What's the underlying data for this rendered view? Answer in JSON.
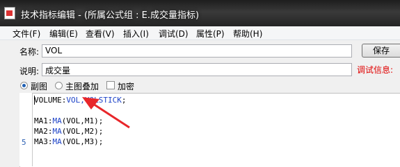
{
  "window": {
    "title": "技术指标编辑 - (所属公式组 : E.成交量指标)"
  },
  "menu": [
    {
      "id": "file",
      "label": "文件(F)"
    },
    {
      "id": "edit",
      "label": "编辑(E)"
    },
    {
      "id": "view",
      "label": "查看(V)"
    },
    {
      "id": "insert",
      "label": "插入(I)"
    },
    {
      "id": "debug",
      "label": "调试(D)"
    },
    {
      "id": "props",
      "label": "属性(P)"
    },
    {
      "id": "help",
      "label": "帮助(H)"
    }
  ],
  "form": {
    "name_label": "名称:",
    "name_value": "VOL",
    "desc_label": "说明:",
    "desc_value": "成交量",
    "save_label": "保存",
    "debug_info_label": "调试信息:"
  },
  "options": {
    "sub_chart": "副图",
    "main_overlay": "主图叠加",
    "encrypt": "加密",
    "selected": "sub_chart",
    "encrypt_checked": false
  },
  "editor": {
    "line_number_shown": "5",
    "lines": {
      "l1a": "VOLUME:",
      "l1b": "VOL,VOLSTICK",
      "l1c": ";",
      "l3a": "MA1:",
      "l3b": "MA",
      "l3c": "(VOL,M1);",
      "l4a": "MA2:",
      "l4b": "MA",
      "l4c": "(VOL,M2);",
      "l5a": "MA3:",
      "l5b": "MA",
      "l5c": "(VOL,M3);"
    }
  },
  "colors": {
    "titlebar": "#2a2a2a",
    "debug_label": "#e00000",
    "arrow": "#e8262a",
    "keyword": "#1e44c8"
  }
}
